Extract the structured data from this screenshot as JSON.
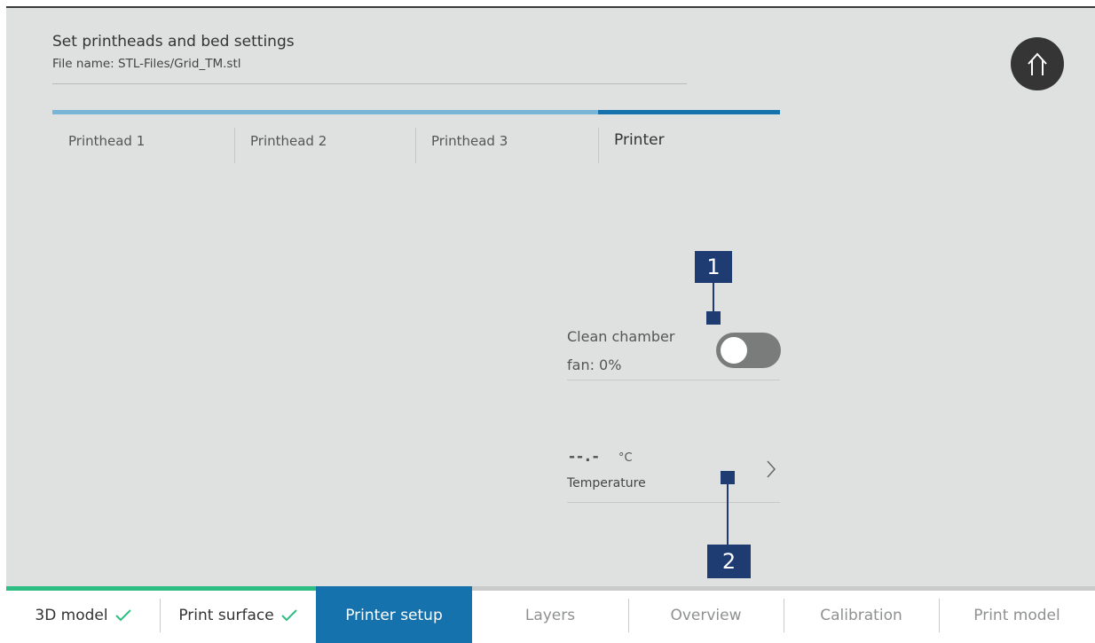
{
  "header": {
    "title": "Set printheads and bed settings",
    "file_name": "File name: STL-Files/Grid_TM.stl"
  },
  "home_button": {
    "icon": "home-icon"
  },
  "tabs": [
    {
      "label": "Printhead 1",
      "active": false
    },
    {
      "label": "Printhead 2",
      "active": false
    },
    {
      "label": "Printhead 3",
      "active": false
    },
    {
      "label": "Printer",
      "active": true
    }
  ],
  "fan_setting": {
    "label_line1": "Clean chamber",
    "label_line2": "fan: 0%",
    "toggle_on": false
  },
  "temperature_setting": {
    "value": "--.-",
    "unit": "°C",
    "label": "Temperature",
    "icon": "chevron-right-icon"
  },
  "callouts": {
    "one": "1",
    "two": "2"
  },
  "workflow_steps": [
    {
      "label": "3D model",
      "status": "done"
    },
    {
      "label": "Print surface",
      "status": "done"
    },
    {
      "label": "Printer setup",
      "status": "current"
    },
    {
      "label": "Layers",
      "status": "future"
    },
    {
      "label": "Overview",
      "status": "future"
    },
    {
      "label": "Calibration",
      "status": "future"
    },
    {
      "label": "Print model",
      "status": "future"
    }
  ],
  "colors": {
    "background": "#dfe1e1",
    "accent": "#1572ac",
    "tab_inactive_bar": "#79b5d6",
    "done_green": "#2ebd82",
    "callout": "#1e3b72"
  }
}
